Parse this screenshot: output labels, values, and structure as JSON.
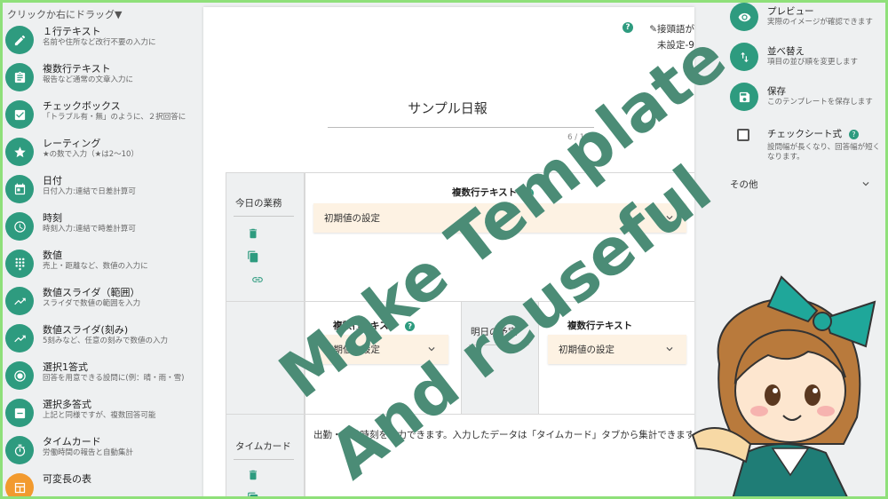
{
  "palette": {
    "header": "クリックか右にドラッグ▼",
    "items": [
      {
        "icon": "pencil-icon",
        "title": "１行テキスト",
        "desc": "名前や住所など改行不要の入力に"
      },
      {
        "icon": "clipboard-icon",
        "title": "複数行テキスト",
        "desc": "報告など通常の文章入力に"
      },
      {
        "icon": "checkbox-icon",
        "title": "チェックボックス",
        "desc": "「トラブル有・無」のように、２択回答に"
      },
      {
        "icon": "star-icon",
        "title": "レーティング",
        "desc": "★の数で入力（★は2〜10）"
      },
      {
        "icon": "calendar-icon",
        "title": "日付",
        "desc": "日付入力:連結で日差計算可"
      },
      {
        "icon": "clock-icon",
        "title": "時刻",
        "desc": "時刻入力:連結で時差計算可"
      },
      {
        "icon": "dialpad-icon",
        "title": "数値",
        "desc": "売上・距離など、数値の入力に"
      },
      {
        "icon": "trending-icon",
        "title": "数値スライダ（範囲）",
        "desc": "スライダで数値の範囲を入力"
      },
      {
        "icon": "trending-icon",
        "title": "数値スライダ(刻み)",
        "desc": "5刻みなど、任意の刻みで数値の入力"
      },
      {
        "icon": "radio-icon",
        "title": "選択1答式",
        "desc": "回答を用意できる設問に(例：晴・雨・雪)"
      },
      {
        "icon": "minus-box-icon",
        "title": "選択多答式",
        "desc": "上記と同様ですが、複数回答可能"
      },
      {
        "icon": "timer-icon",
        "title": "タイムカード",
        "desc": "労働時間の報告と自動集計"
      },
      {
        "icon": "table-icon",
        "title": "可変長の表",
        "desc": ""
      }
    ]
  },
  "editor": {
    "help": "?",
    "prefix_label": "接頭語が未設定-9",
    "title": "サンプル日報",
    "char_count": "6 / 128",
    "rows": [
      {
        "label": "今日の業務",
        "field_title": "複数行テキスト",
        "dropdown": "初期値の設定"
      },
      {
        "label": "",
        "field_title": "複数行テキスト",
        "dropdown": "初期値の設定",
        "label2": "明日の予定",
        "field_title2": "複数行テキスト",
        "dropdown2": "初期値の設定"
      },
      {
        "label": "タイムカード",
        "body": "出勤・退勤時刻を入力できます。入力したデータは「タイムカード」タブから集計できます。"
      }
    ]
  },
  "right_panel": {
    "items": [
      {
        "icon": "eye-icon",
        "title": "プレビュー",
        "desc": "実際のイメージが確認できます"
      },
      {
        "icon": "sort-icon",
        "title": "並べ替え",
        "desc": "項目の並び順を変更します"
      },
      {
        "icon": "save-icon",
        "title": "保存",
        "desc": "このテンプレートを保存します"
      }
    ],
    "checksheet": {
      "title": "チェックシート式",
      "desc": "設問幅が長くなり、回答幅が短くなります。"
    },
    "other": "その他"
  },
  "overlay": {
    "line1": "Make Template",
    "line2": "And reuseful"
  },
  "colors": {
    "accent": "#2e9b7f",
    "banner_text": "#4b8c76",
    "frame": "#8fe07a",
    "dropdown_bg": "#fdf2e3"
  }
}
